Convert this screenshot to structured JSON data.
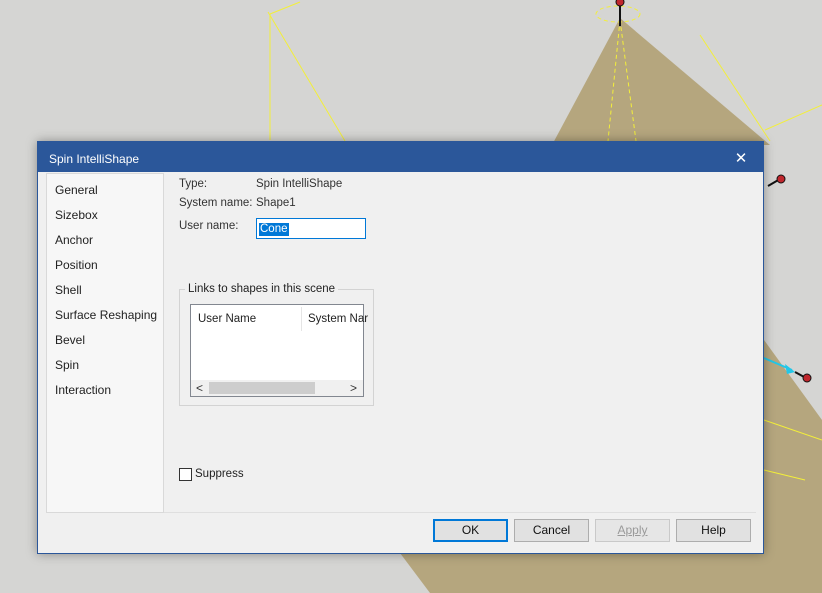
{
  "dialog": {
    "title": "Spin IntelliShape",
    "close_glyph": "✕"
  },
  "nav": {
    "items": [
      {
        "label": "General"
      },
      {
        "label": "Sizebox"
      },
      {
        "label": "Anchor"
      },
      {
        "label": "Position"
      },
      {
        "label": "Shell"
      },
      {
        "label": "Surface Reshaping"
      },
      {
        "label": "Bevel"
      },
      {
        "label": "Spin"
      },
      {
        "label": "Interaction"
      }
    ]
  },
  "general": {
    "type_label": "Type:",
    "type_value": "Spin IntelliShape",
    "sysname_label": "System name:",
    "sysname_value": "Shape1",
    "username_label": "User name:",
    "username_value": "Cone"
  },
  "links": {
    "title": "Links to shapes in this scene",
    "columns": [
      "User Name",
      "System Nar"
    ],
    "scroll_left": "<",
    "scroll_right": ">"
  },
  "suppress": {
    "label": "Suppress",
    "checked": false
  },
  "buttons": {
    "ok": "OK",
    "cancel": "Cancel",
    "apply": "Apply",
    "help": "Help"
  },
  "colors": {
    "titlebar": "#2b579a",
    "accent": "#0078d7",
    "cone_fill": "#b5a67e"
  }
}
